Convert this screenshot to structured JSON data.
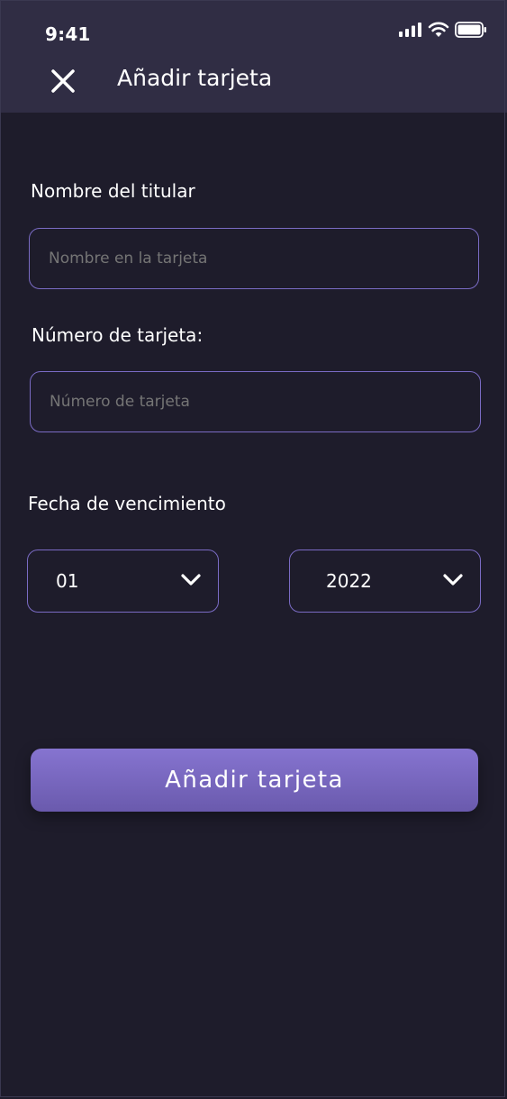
{
  "status_bar": {
    "time": "9:41",
    "icons": [
      "cellular-signal-icon",
      "wifi-icon",
      "battery-icon"
    ]
  },
  "header": {
    "close_icon": "close-icon",
    "title": "Añadir tarjeta"
  },
  "form": {
    "holder": {
      "label": "Nombre del titular",
      "placeholder": "Nombre en la tarjeta",
      "value": ""
    },
    "card_number": {
      "label": "Número de tarjeta:",
      "placeholder": "Número de tarjeta",
      "value": ""
    },
    "expiry": {
      "label": "Fecha de vencimiento",
      "month": "01",
      "year": "2022"
    }
  },
  "submit_label": "Añadir tarjeta",
  "colors": {
    "background": "#1e1c2b",
    "app_bar": "#302d44",
    "border_accent": "#7a6bc4",
    "button_top": "#8674d0",
    "button_bottom": "#6a5aad",
    "placeholder_text": "#8f8ca3"
  }
}
